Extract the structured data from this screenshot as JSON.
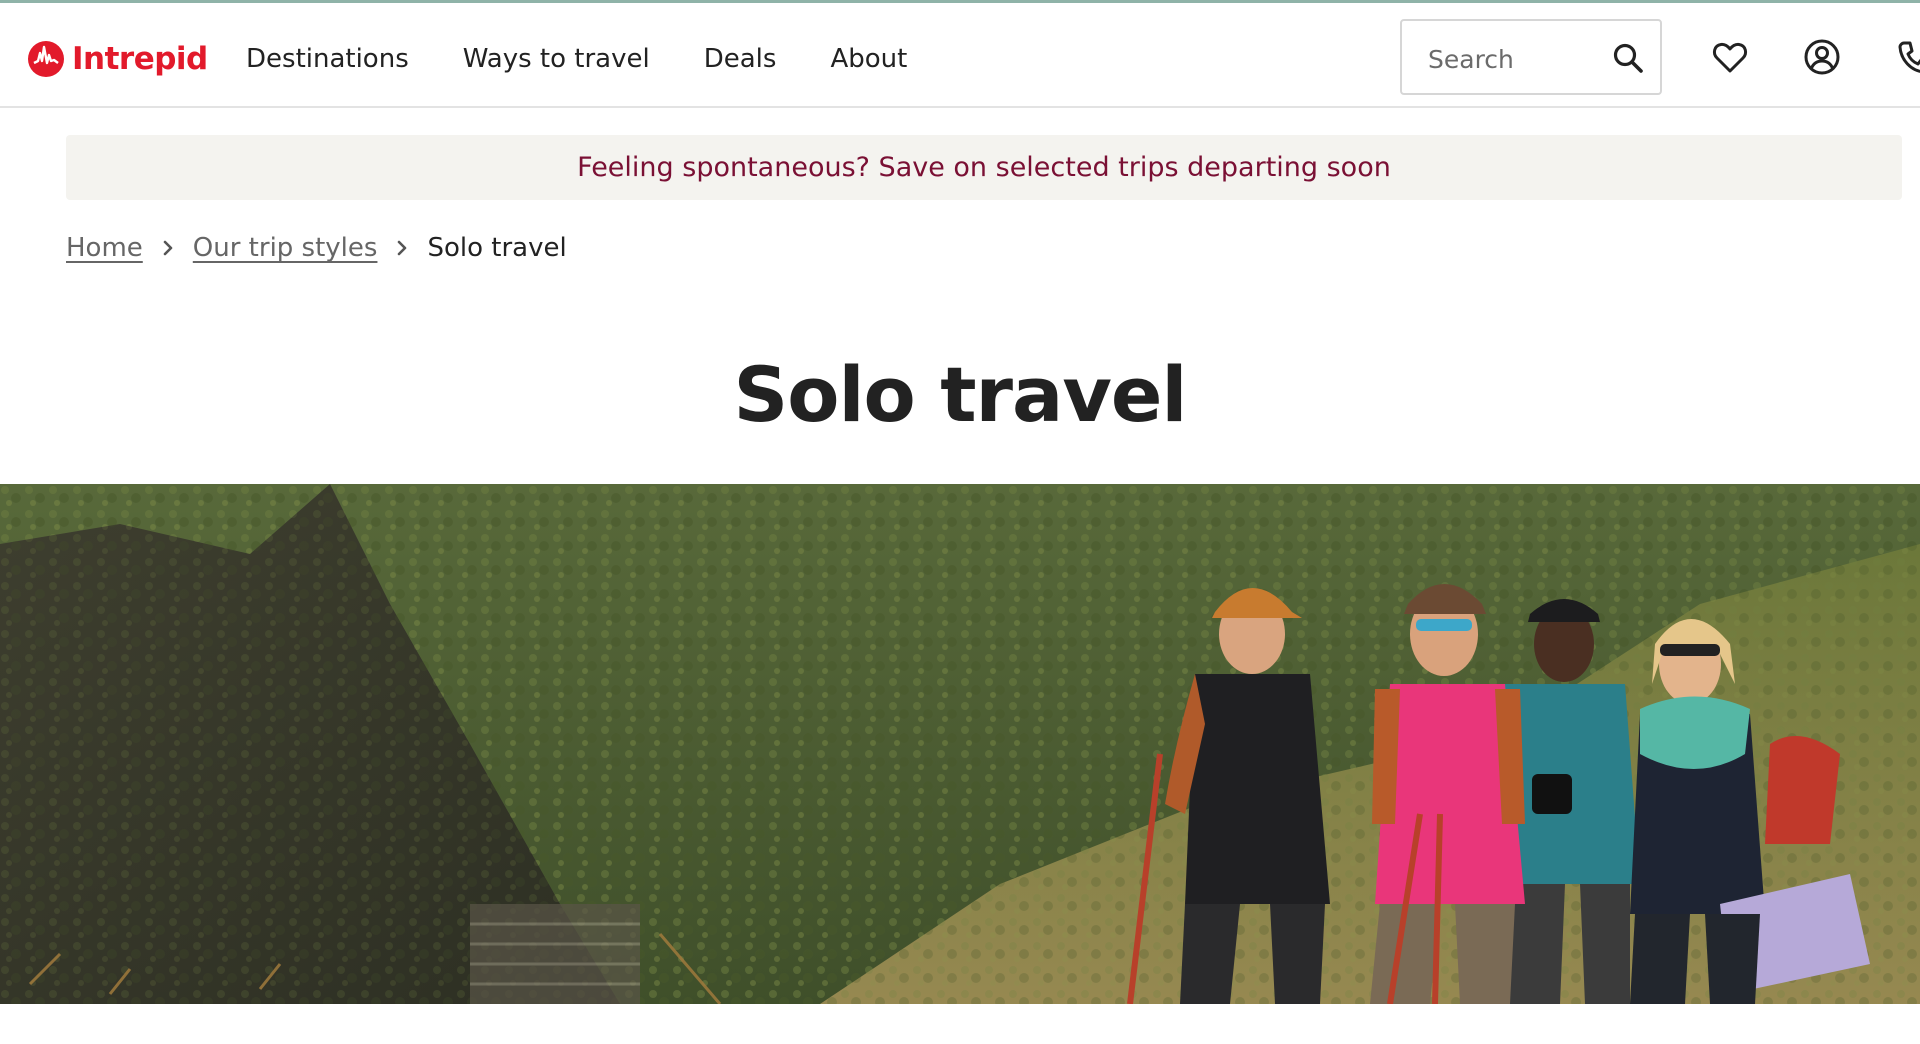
{
  "header": {
    "logo_text": "Intrepid",
    "nav": [
      {
        "label": "Destinations"
      },
      {
        "label": "Ways to travel"
      },
      {
        "label": "Deals"
      },
      {
        "label": "About"
      }
    ],
    "search": {
      "placeholder": "Search",
      "value": ""
    },
    "icons": [
      "search-icon",
      "heart-icon",
      "account-icon",
      "phone-icon"
    ]
  },
  "promo": {
    "text": "Feeling spontaneous? Save on selected trips departing soon"
  },
  "breadcrumb": {
    "items": [
      {
        "label": "Home"
      },
      {
        "label": "Our trip styles"
      }
    ],
    "current": "Solo travel"
  },
  "page": {
    "title": "Solo travel"
  },
  "colors": {
    "brand_red": "#e21a2b",
    "promo_text": "#7a1034",
    "promo_bg": "#f4f3ef",
    "header_top_border": "#8fb3a8"
  }
}
